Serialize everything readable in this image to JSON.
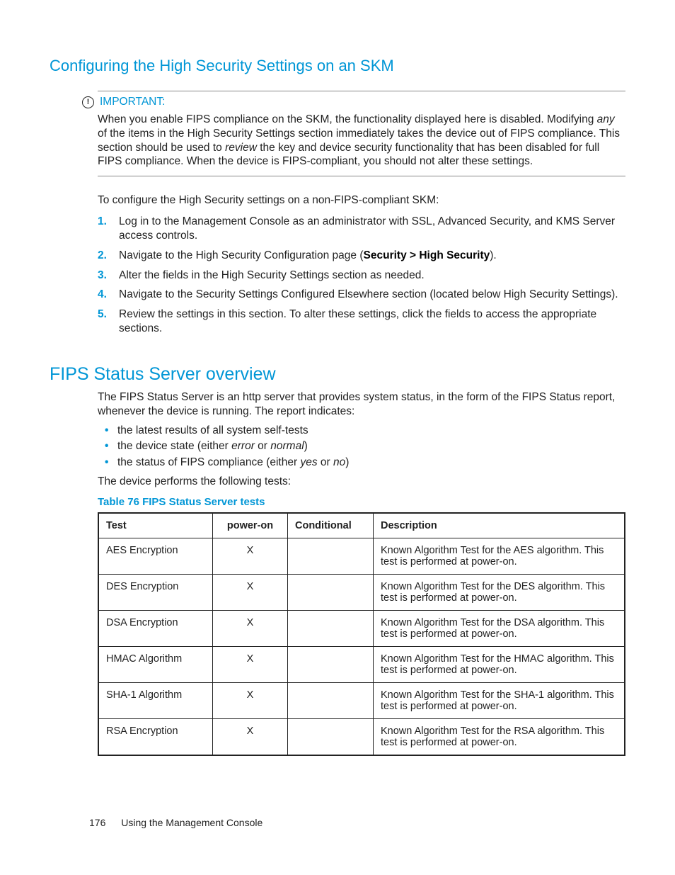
{
  "section1": {
    "title": "Configuring the High Security Settings on an SKM",
    "important_label": "IMPORTANT:",
    "important_text_pre": "When you enable FIPS compliance on the SKM, the functionality displayed here is disabled. Modifying ",
    "important_text_ital": "any",
    "important_text_mid": " of the items in the High Security Settings section immediately takes the device out of FIPS compliance. This section should be used to ",
    "important_text_ital2": "review",
    "important_text_post": " the key and device security functionality that has been disabled for full FIPS compliance. When the device is FIPS-compliant, you should not alter these settings.",
    "intro": "To configure the High Security settings on a non-FIPS-compliant SKM:",
    "steps": [
      "Log in to the Management Console as an administrator with SSL, Advanced Security, and KMS Server access controls.",
      "",
      "Alter the fields in the High Security Settings section as needed.",
      "Navigate to the Security Settings Configured Elsewhere section (located below High Security Settings).",
      "Review the settings in this section. To alter these settings, click the fields to access the appropriate sections."
    ],
    "step2_pre": "Navigate to the High Security Configuration page (",
    "step2_bold": "Security > High Security",
    "step2_post": ")."
  },
  "section2": {
    "title": "FIPS Status Server overview",
    "intro": "The FIPS Status Server is an http server that provides system status, in the form of the FIPS Status report, whenever the device is running. The report indicates:",
    "bullets_data": [
      {
        "pre": "the latest results of all system self-tests",
        "i1": "",
        "mid": "",
        "i2": "",
        "post": ""
      },
      {
        "pre": "the device state (either ",
        "i1": "error",
        "mid": " or ",
        "i2": "normal",
        "post": ")"
      },
      {
        "pre": "the status of FIPS compliance (either ",
        "i1": "yes",
        "mid": " or ",
        "i2": "no",
        "post": ")"
      }
    ],
    "post_bullets": "The device performs the following tests:",
    "table_title": "Table 76 FIPS Status Server tests",
    "headers": {
      "test": "Test",
      "poweron": "power-on",
      "conditional": "Conditional",
      "description": "Description"
    },
    "rows": [
      {
        "test": "AES Encryption",
        "poweron": "X",
        "conditional": "",
        "description": "Known Algorithm Test for the AES algorithm. This test is performed at power-on."
      },
      {
        "test": "DES Encryption",
        "poweron": "X",
        "conditional": "",
        "description": "Known Algorithm Test for the DES algorithm. This test is performed at power-on."
      },
      {
        "test": "DSA Encryption",
        "poweron": "X",
        "conditional": "",
        "description": "Known Algorithm Test for the DSA algorithm. This test is performed at power-on."
      },
      {
        "test": "HMAC Algorithm",
        "poweron": "X",
        "conditional": "",
        "description": "Known Algorithm Test for the HMAC algorithm. This test is performed at power-on."
      },
      {
        "test": "SHA-1 Algorithm",
        "poweron": "X",
        "conditional": "",
        "description": "Known Algorithm Test for the SHA-1 algorithm. This test is performed at power-on."
      },
      {
        "test": "RSA Encryption",
        "poweron": "X",
        "conditional": "",
        "description": "Known Algorithm Test for the RSA algorithm. This test is performed at power-on."
      }
    ]
  },
  "footer": {
    "page": "176",
    "chapter": "Using the Management Console"
  }
}
